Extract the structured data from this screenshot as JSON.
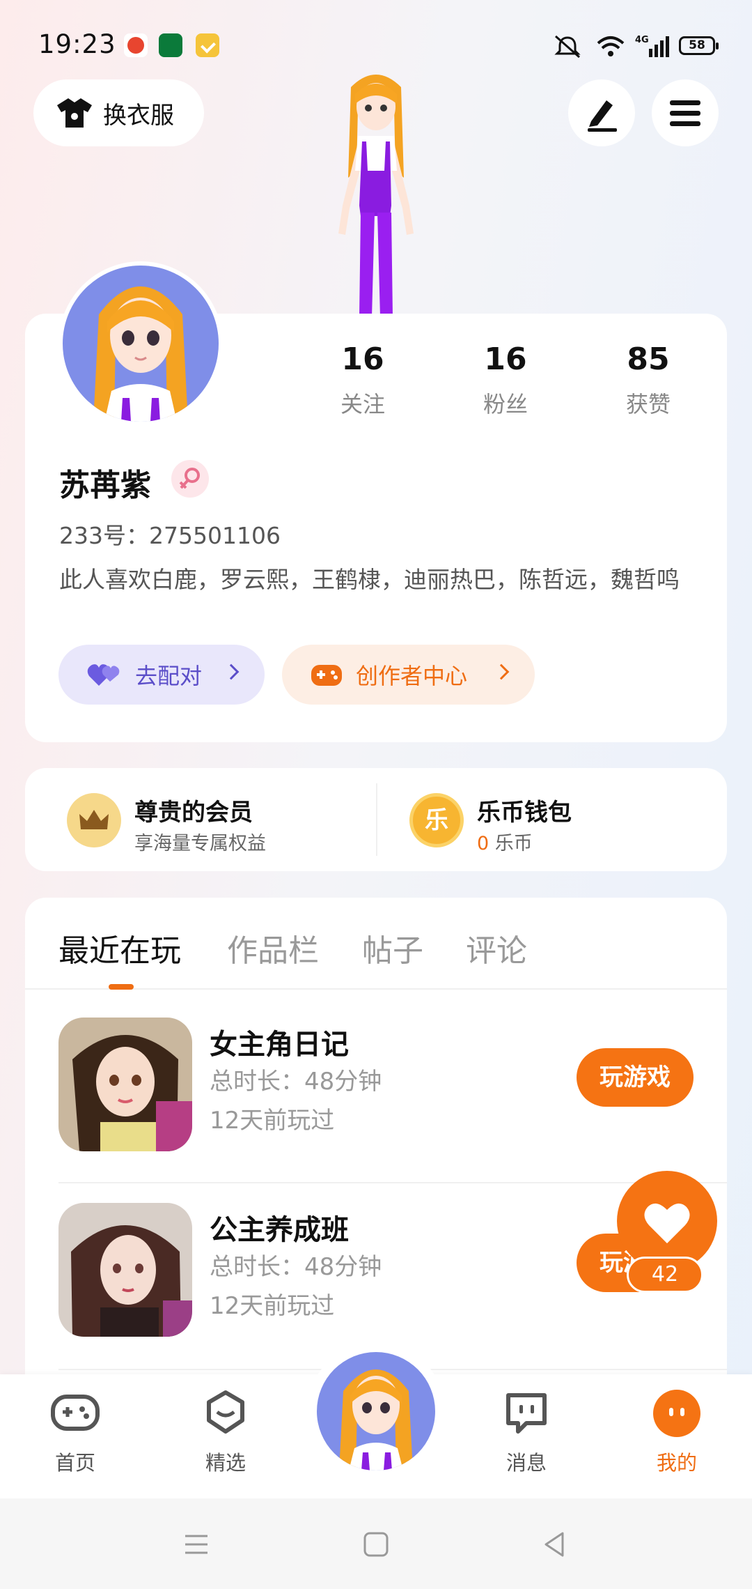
{
  "status_bar": {
    "time": "19:23",
    "battery": "58",
    "network": "4G"
  },
  "top_bar": {
    "outfit_label": "换衣服"
  },
  "profile": {
    "stats": [
      {
        "value": "16",
        "label": "关注"
      },
      {
        "value": "16",
        "label": "粉丝"
      },
      {
        "value": "85",
        "label": "获赞"
      }
    ],
    "name": "苏苒紫",
    "id_text": "233号：275501106",
    "bio": "此人喜欢白鹿，罗云熙，王鹤棣，迪丽热巴，陈哲远，魏哲鸣",
    "match_label": "去配对",
    "creator_label": "创作者中心"
  },
  "vip": {
    "member_title": "尊贵的会员",
    "member_sub": "享海量专属权益",
    "wallet_title": "乐币钱包",
    "coin_glyph": "乐",
    "coin_count": "0",
    "coin_unit": " 乐币"
  },
  "tabs": [
    {
      "label": "最近在玩",
      "active": true
    },
    {
      "label": "作品栏",
      "active": false
    },
    {
      "label": "帖子",
      "active": false
    },
    {
      "label": "评论",
      "active": false
    }
  ],
  "games": [
    {
      "title": "女主角日记",
      "duration": "总时长：48分钟",
      "last_played": "12天前玩过",
      "button": "玩游戏"
    },
    {
      "title": "公主养成班",
      "duration": "总时长：48分钟",
      "last_played": "12天前玩过",
      "button": "玩游戏"
    }
  ],
  "like": {
    "count": "42"
  },
  "nav": [
    {
      "label": "首页",
      "icon": "gamepad-icon"
    },
    {
      "label": "精选",
      "icon": "heart-chat-icon"
    },
    {
      "label": "消息",
      "icon": "message-icon"
    },
    {
      "label": "我的",
      "icon": "profile-face-icon"
    }
  ],
  "colors": {
    "accent": "#f57313",
    "match": "#5b4ec9",
    "match_bg": "#e9e7fb",
    "creator_bg": "#fdeee4"
  }
}
